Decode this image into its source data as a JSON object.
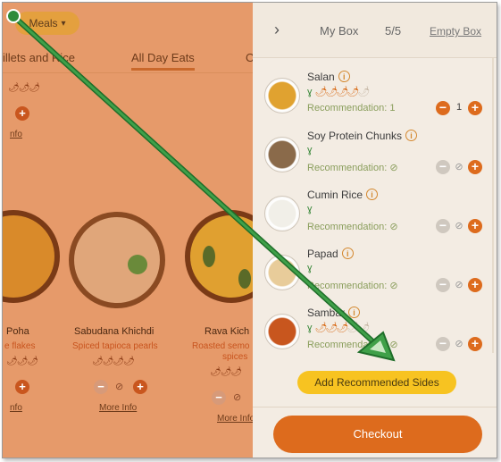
{
  "background_page": {
    "meals_dropdown": "Meals",
    "categories": [
      "illets and Rice",
      "All Day Eats",
      "O"
    ],
    "active_category": "All Day Eats",
    "dishes": [
      {
        "name": "Poha",
        "desc": "e flakes",
        "more": "nfo"
      },
      {
        "name": "Sabudana Khichdi",
        "desc": "Spiced tapioca pearls",
        "more": "More Info"
      },
      {
        "name": "Rava Kich",
        "desc": "Roasted semo",
        "desc2": "spices",
        "more": "More Info"
      }
    ],
    "top_more_info": "nfo",
    "null_symbol": "⊘"
  },
  "drawer": {
    "collapse_icon": "›",
    "title": "My Box",
    "count": "5/5",
    "empty_label": "Empty Box",
    "items": [
      {
        "name": "Salan",
        "reco": "Recommendation: 1",
        "qty": "1",
        "chili_on": 4,
        "chili_max": 5,
        "color": "#e0a230"
      },
      {
        "name": "Soy Protein Chunks",
        "reco": "Recommendation: ⊘",
        "qty": "⊘",
        "chili_on": 0,
        "chili_max": 0,
        "color": "#8a6a4a"
      },
      {
        "name": "Cumin Rice",
        "reco": "Recommendation: ⊘",
        "qty": "⊘",
        "chili_on": 0,
        "chili_max": 0,
        "color": "#f1efe8"
      },
      {
        "name": "Papad",
        "reco": "Recommendation: ⊘",
        "qty": "⊘",
        "chili_on": 0,
        "chili_max": 0,
        "color": "#e8cc9a"
      },
      {
        "name": "Sambar",
        "reco": "Recommendation: ⊘",
        "qty": "⊘",
        "chili_on": 3,
        "chili_max": 5,
        "color": "#c8561e"
      }
    ],
    "add_recommended_label": "Add Recommended Sides",
    "checkout_label": "Checkout"
  },
  "colors": {
    "accent_orange": "#dd6b1d",
    "add_button_yellow": "#f7c321",
    "veg_green": "#3d8a3d",
    "annotation_green": "#2e8b3a"
  }
}
